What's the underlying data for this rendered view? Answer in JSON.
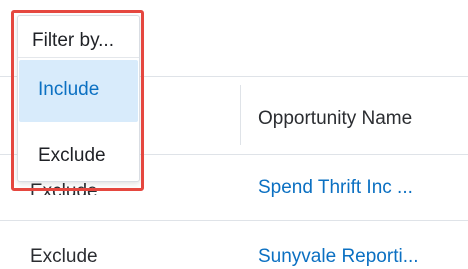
{
  "filter_menu": {
    "title": "Filter by...",
    "options": [
      {
        "label": "Include",
        "selected": true
      },
      {
        "label": "Exclude",
        "selected": false
      }
    ]
  },
  "table": {
    "columns": [
      "Opportunity Name"
    ],
    "rows": [
      {
        "action": "Exclude",
        "opportunity_name": "Spend Thrift Inc ..."
      },
      {
        "action": "Exclude",
        "opportunity_name": "Sunyvale Reporti..."
      }
    ]
  },
  "colors": {
    "link": "#0b70c2",
    "selected_bg": "#d8ebfb",
    "highlight": "#e5473f"
  }
}
